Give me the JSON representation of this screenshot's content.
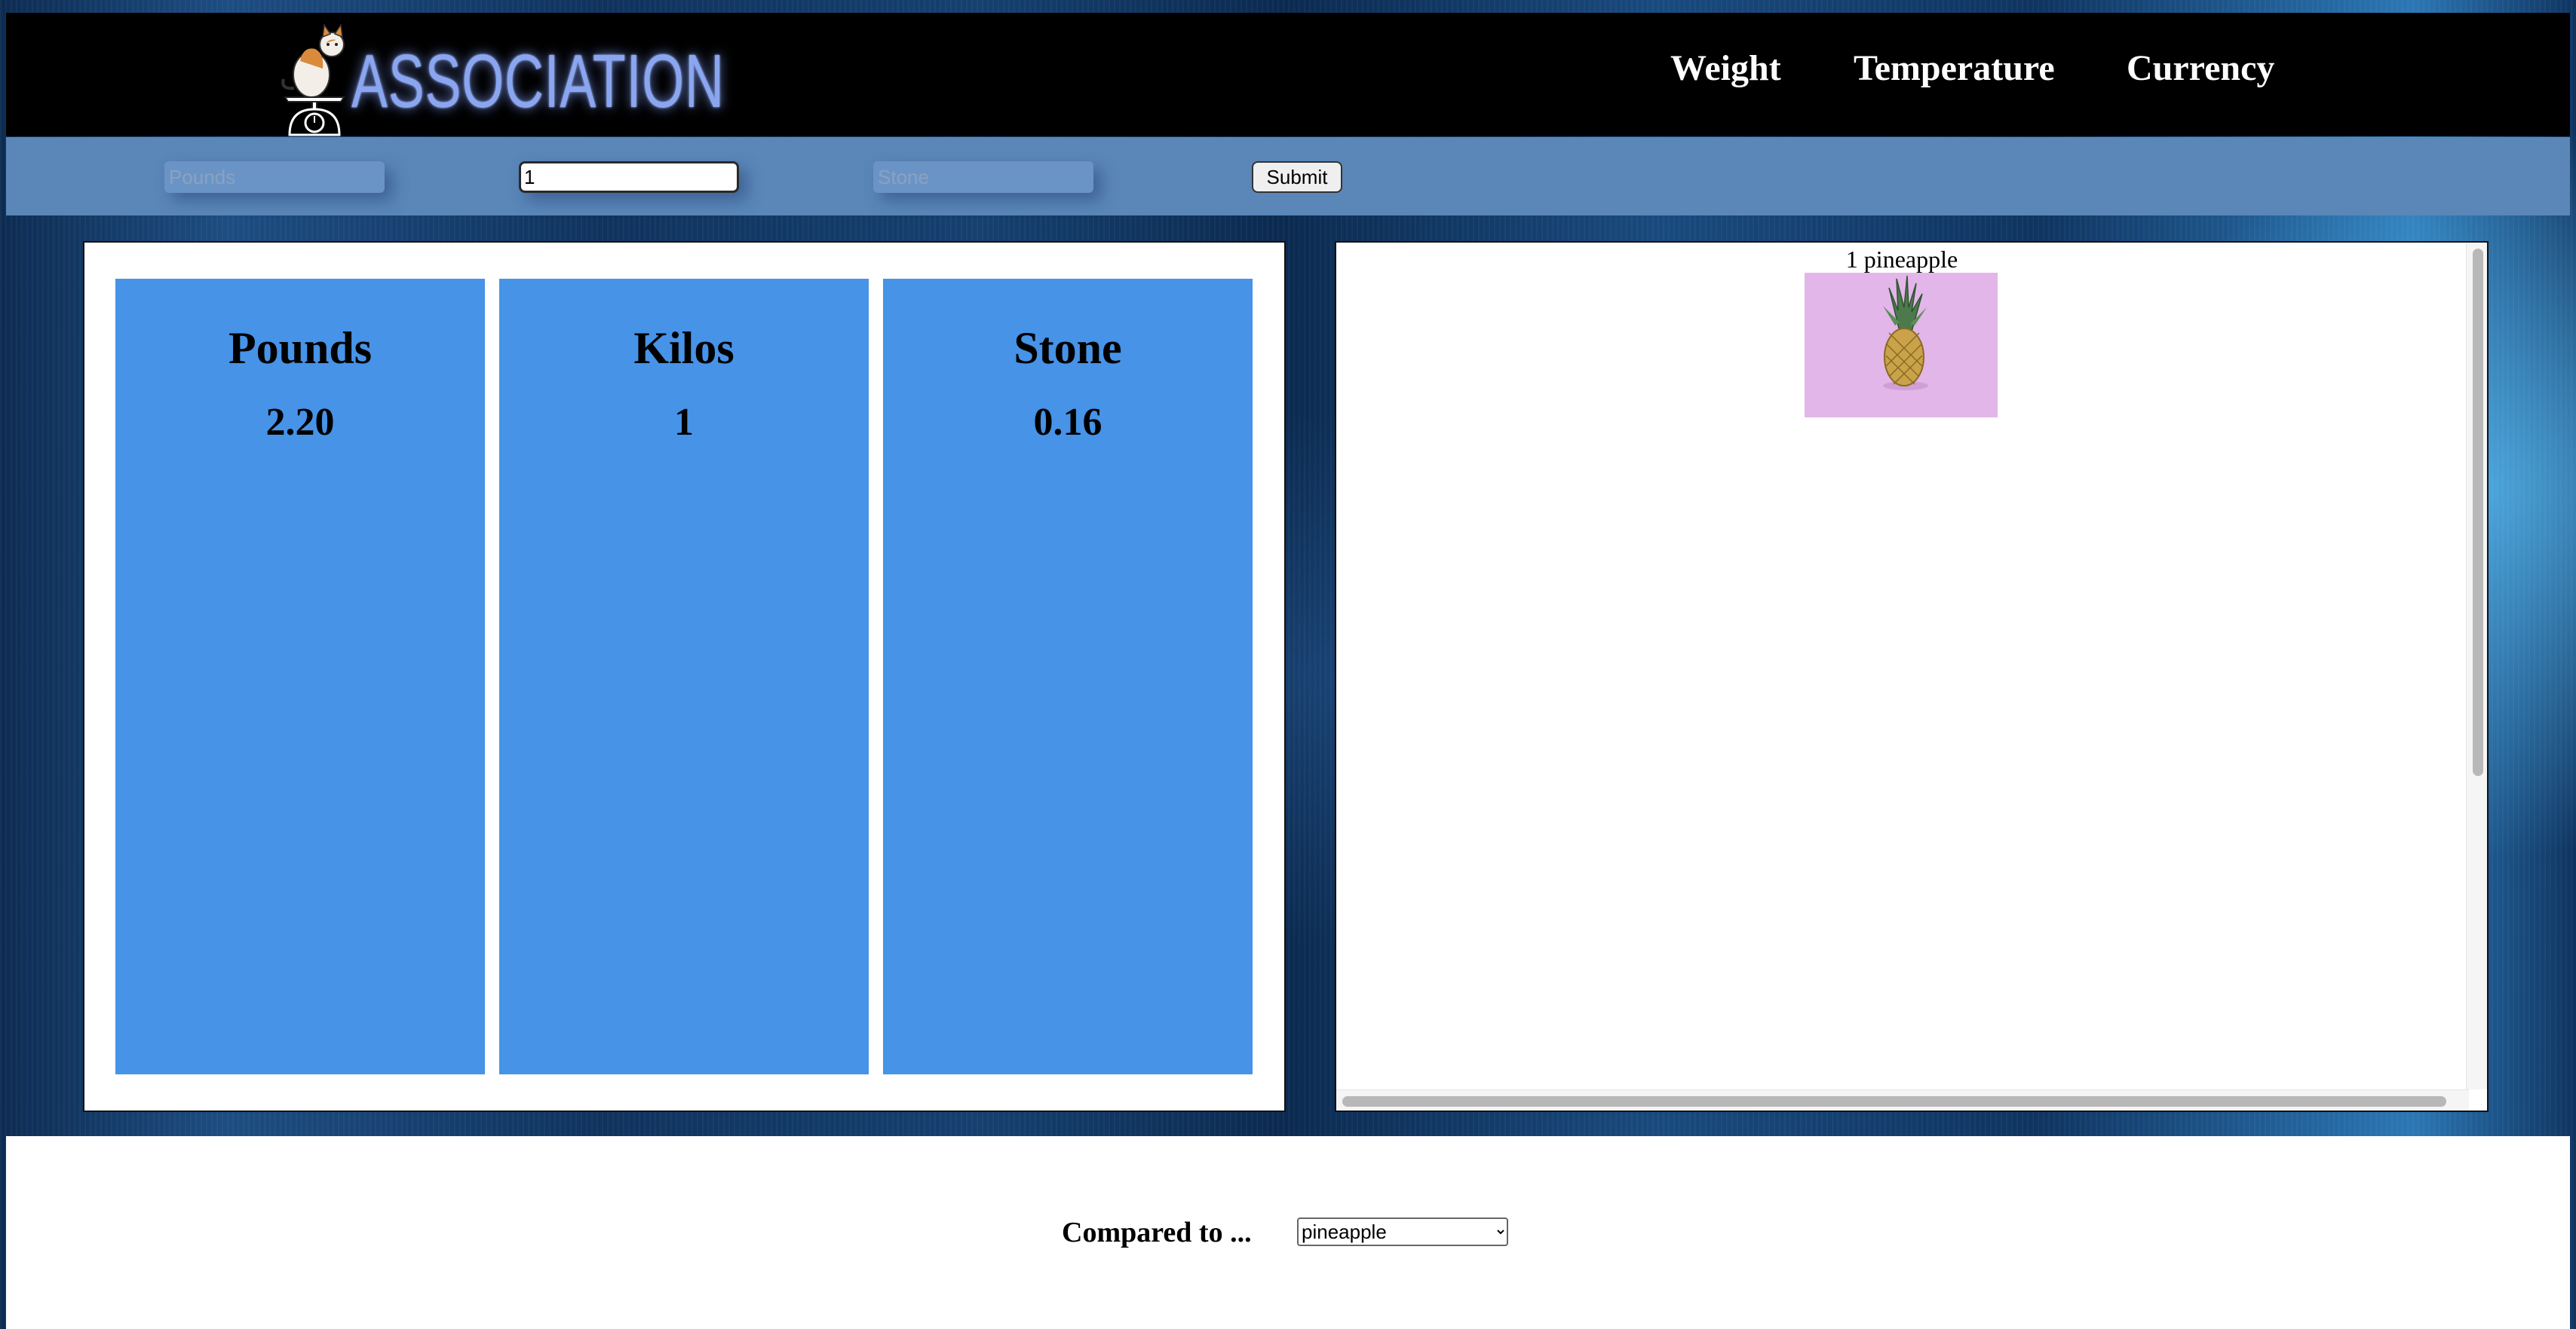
{
  "header": {
    "logo_text": "ASSOCIATION",
    "nav": [
      {
        "label": "Weight"
      },
      {
        "label": "Temperature"
      },
      {
        "label": "Currency"
      }
    ]
  },
  "inputs": {
    "pounds_placeholder": "Pounds",
    "kilos_value": "1",
    "stone_placeholder": "Stone",
    "submit_label": "Submit"
  },
  "units": [
    {
      "name": "Pounds",
      "value": "2.20"
    },
    {
      "name": "Kilos",
      "value": "1"
    },
    {
      "name": "Stone",
      "value": "0.16"
    }
  ],
  "comparison": {
    "label": "1 pineapple"
  },
  "footer": {
    "label": "Compared to ...",
    "selected": "pineapple"
  },
  "colors": {
    "card_blue": "#4693e8",
    "input_bar": "#5a86b8",
    "logo_glow": "#8aa6f0"
  }
}
